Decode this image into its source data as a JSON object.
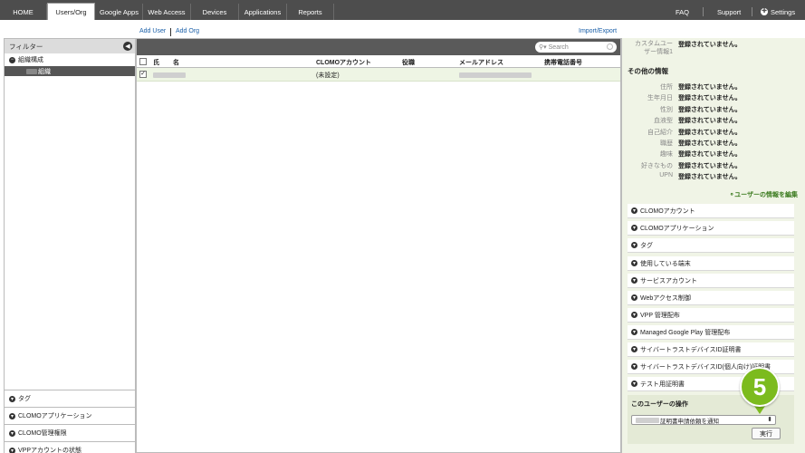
{
  "nav": {
    "tabs": [
      "HOME",
      "Users/Org",
      "Google Apps",
      "Web Access",
      "Devices",
      "Applications",
      "Reports"
    ],
    "right": [
      "FAQ",
      "Support",
      "Settings"
    ]
  },
  "toolbar": {
    "add_user": "Add User",
    "add_org": "Add Org",
    "import_export": "Import/Export"
  },
  "left": {
    "header": "フィルター",
    "collapse_icon": "◀",
    "tree_root": "組織構成",
    "tree_selected": "組織",
    "accordions": [
      "タグ",
      "CLOMOアプリケーション",
      "CLOMO管理権限",
      "VPPアカウントの状態"
    ]
  },
  "table": {
    "search_placeholder": "Search",
    "columns": [
      "氏",
      "名",
      "CLOMOアカウント",
      "役職",
      "メールアドレス",
      "携帯電話番号"
    ],
    "row": {
      "account": "(未設定)",
      "checked": "✓"
    }
  },
  "right": {
    "custom_label": "カスタムユーザー情報1",
    "custom_label_l1": "カスタムユー",
    "custom_label_l2": "ザー情報1",
    "unset": "登録されていません。",
    "other_title": "その他の情報",
    "fields": [
      "住所",
      "生年月日",
      "性別",
      "血液型",
      "自己紹介",
      "職歴",
      "趣味",
      "好きなもの",
      "UPN"
    ],
    "edit_link": "ユーザーの情報を編集",
    "accordions": [
      "CLOMOアカウント",
      "CLOMOアプリケーション",
      "タグ",
      "使用している端末",
      "サービスアカウント",
      "Webアクセス制御",
      "VPP 管理配布",
      "Managed Google Play 管理配布",
      "サイバートラストデバイスID証明書",
      "サイバートラストデバイスID(個人向け)証明書",
      "テスト用証明書"
    ],
    "ops_title": "このユーザーの操作",
    "ops_select": "証明書申請依頼を通知",
    "ops_button": "実行"
  },
  "badge": "5"
}
